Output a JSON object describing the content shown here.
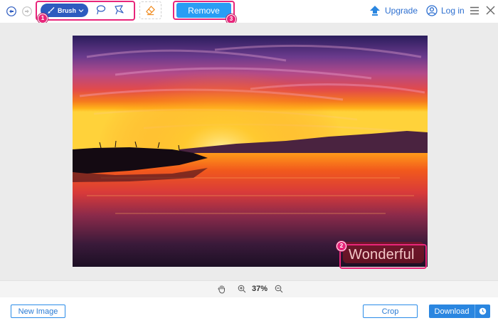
{
  "toolbar": {
    "brush_label": "Brush",
    "remove_label": "Remove",
    "upgrade_label": "Upgrade",
    "login_label": "Log in",
    "badges": {
      "one": "1",
      "two": "2",
      "three": "3"
    },
    "icons": {
      "undo": "undo-icon",
      "redo": "redo-icon",
      "brush": "brush-icon",
      "lasso": "lasso-icon",
      "polygon": "polygon-lasso-icon",
      "eraser": "eraser-icon",
      "upgrade": "upgrade-arrow-icon",
      "user": "user-icon",
      "menu": "menu-icon",
      "close": "close-icon"
    }
  },
  "canvas": {
    "watermark_text": "Wonderful"
  },
  "zoom": {
    "value": "37%"
  },
  "footer": {
    "new_image_label": "New Image",
    "crop_label": "Crop",
    "download_label": "Download"
  },
  "colors": {
    "accent": "#2a9df4",
    "brand_blue": "#2d5bbf",
    "highlight": "#e8257a",
    "link": "#2d6fd0"
  }
}
